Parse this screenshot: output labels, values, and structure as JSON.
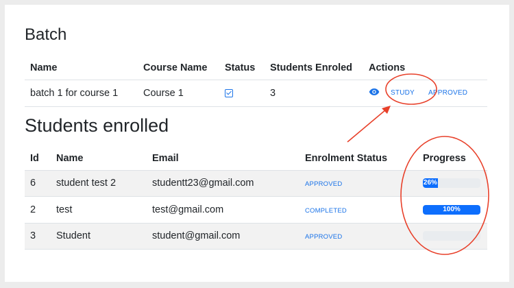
{
  "batch": {
    "title": "Batch",
    "columns": [
      "Name",
      "Course Name",
      "Status",
      "Students Enroled",
      "Actions"
    ],
    "row": {
      "name": "batch 1 for course 1",
      "course_name": "Course 1",
      "status_icon": "checkbox-checked-icon",
      "students_enroled": "3",
      "actions": {
        "view_icon": "eye-icon",
        "study_label": "STUDY",
        "approved_label": "APPROVED"
      }
    }
  },
  "students": {
    "title": "Students enrolled",
    "columns": [
      "Id",
      "Name",
      "Email",
      "Enrolment Status",
      "Progress"
    ],
    "rows": [
      {
        "id": "6",
        "name": "student test 2",
        "email": "studentt23@gmail.com",
        "status": "APPROVED",
        "progress": 26,
        "progress_label": "26%"
      },
      {
        "id": "2",
        "name": "test",
        "email": "test@gmail.com",
        "status": "COMPLETED",
        "progress": 100,
        "progress_label": "100%"
      },
      {
        "id": "3",
        "name": "Student",
        "email": "student@gmail.com",
        "status": "APPROVED",
        "progress": 0,
        "progress_label": ""
      }
    ]
  },
  "colors": {
    "accent": "#1a73e8",
    "progress_fill": "#0d6efd",
    "annotation": "#e8402a"
  }
}
